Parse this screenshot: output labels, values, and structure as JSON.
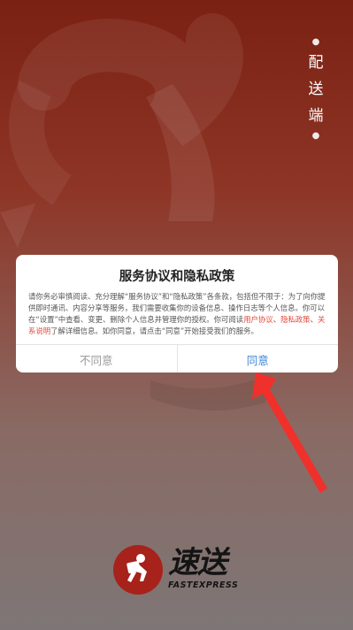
{
  "app": {
    "side_title_chars": [
      "配",
      "送",
      "端"
    ],
    "brand_cn": "速送",
    "brand_en": "FASTEXPRESS"
  },
  "dialog": {
    "title": "服务协议和隐私政策",
    "body_part1": "请你务必审慎阅读、充分理解“服务协议”和“隐私政策”各条款，包括但不限于：为了向你提供即时通讯、内容分享等服务，我们需要收集你的设备信息、操作日志等个人信息。你可以在“设置”中查看、变更、删除个人信息并管理你的授权。你可阅读",
    "link_service": "用户协议",
    "sep": "、",
    "link_privacy": "隐私政策",
    "link_rules": "关系说明",
    "body_part2": "了解详细信息。如你同意，请点击“同意”开始接受我们的服务。",
    "cancel_label": "不同意",
    "agree_label": "同意"
  },
  "colors": {
    "accent_red": "#e0483b",
    "agree_blue": "#3d86d8",
    "arrow_red": "#f0302b"
  }
}
